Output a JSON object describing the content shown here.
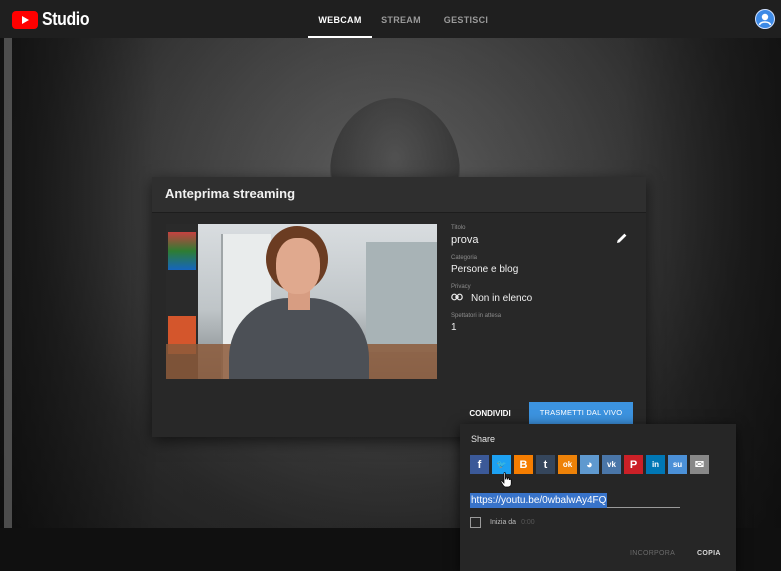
{
  "app": {
    "logo_text": "Studio"
  },
  "tabs": [
    {
      "label": "WEBCAM",
      "active": true
    },
    {
      "label": "STREAM",
      "active": false
    },
    {
      "label": "GESTISCI",
      "active": false
    }
  ],
  "dialog": {
    "title": "Anteprima streaming",
    "fields": {
      "title_label": "Titolo",
      "title_value": "prova",
      "category_label": "Categoria",
      "category_value": "Persone e blog",
      "privacy_label": "Privacy",
      "privacy_value": "Non in elenco",
      "waiting_label": "Spettatori in attesa",
      "waiting_value": "1"
    },
    "share_button": "CONDIVIDI",
    "live_button": "TRASMETTI DAL VIVO"
  },
  "share_popup": {
    "title": "Share",
    "icons": [
      {
        "name": "facebook-icon",
        "glyph": "f",
        "color": "#3b5998"
      },
      {
        "name": "twitter-icon",
        "glyph": "🐦",
        "color": "#1da1f2"
      },
      {
        "name": "blogger-icon",
        "glyph": "B",
        "color": "#f57d00"
      },
      {
        "name": "tumblr-icon",
        "glyph": "t",
        "color": "#35465c"
      },
      {
        "name": "odnoklassniki-icon",
        "glyph": "ok",
        "color": "#ee8208"
      },
      {
        "name": "reddit-icon",
        "glyph": "◕",
        "color": "#5f99cf"
      },
      {
        "name": "vk-icon",
        "glyph": "vk",
        "color": "#4a76a8"
      },
      {
        "name": "pinterest-icon",
        "glyph": "P",
        "color": "#cb2027"
      },
      {
        "name": "linkedin-icon",
        "glyph": "in",
        "color": "#0077b5"
      },
      {
        "name": "stumbleupon-icon",
        "glyph": "su",
        "color": "#4b90d7"
      },
      {
        "name": "email-icon",
        "glyph": "✉",
        "color": "#888888"
      }
    ],
    "url": "https://youtu.be/0wbalwAy4FQ",
    "start_at_label": "Inizia da",
    "start_at_time": "0:00",
    "embed_button": "INCORPORA",
    "copy_button": "COPIA"
  }
}
